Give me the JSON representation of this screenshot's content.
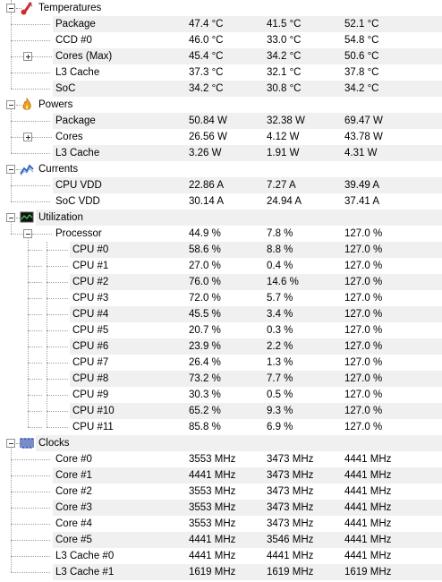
{
  "sections": [
    {
      "name": "temperatures",
      "label": "Temperatures",
      "icon": "thermometer-icon",
      "rows": [
        {
          "label": "Package",
          "level": 1,
          "expander": null,
          "values": [
            "47.4 °C",
            "41.5 °C",
            "52.1 °C"
          ]
        },
        {
          "label": "CCD #0",
          "level": 1,
          "expander": null,
          "values": [
            "46.0 °C",
            "33.0 °C",
            "54.8 °C"
          ]
        },
        {
          "label": "Cores (Max)",
          "level": 1,
          "expander": "plus",
          "values": [
            "45.4 °C",
            "34.2 °C",
            "50.6 °C"
          ]
        },
        {
          "label": "L3 Cache",
          "level": 1,
          "expander": null,
          "values": [
            "37.3 °C",
            "32.1 °C",
            "37.8 °C"
          ]
        },
        {
          "label": "SoC",
          "level": 1,
          "expander": null,
          "values": [
            "34.2 °C",
            "30.8 °C",
            "34.2 °C"
          ]
        }
      ]
    },
    {
      "name": "powers",
      "label": "Powers",
      "icon": "flame-icon",
      "rows": [
        {
          "label": "Package",
          "level": 1,
          "expander": null,
          "values": [
            "50.84 W",
            "32.38 W",
            "69.47 W"
          ]
        },
        {
          "label": "Cores",
          "level": 1,
          "expander": "plus",
          "values": [
            "26.56 W",
            "4.12 W",
            "43.78 W"
          ]
        },
        {
          "label": "L3 Cache",
          "level": 1,
          "expander": null,
          "values": [
            "3.26 W",
            "1.91 W",
            "4.31 W"
          ]
        }
      ]
    },
    {
      "name": "currents",
      "label": "Currents",
      "icon": "current-graph-icon",
      "rows": [
        {
          "label": "CPU VDD",
          "level": 1,
          "expander": null,
          "values": [
            "22.86 A",
            "7.27 A",
            "39.49 A"
          ]
        },
        {
          "label": "SoC VDD",
          "level": 1,
          "expander": null,
          "values": [
            "30.14 A",
            "24.94 A",
            "37.41 A"
          ]
        }
      ]
    },
    {
      "name": "utilization",
      "label": "Utilization",
      "icon": "monitor-chart-icon",
      "rows": [
        {
          "label": "Processor",
          "level": 1,
          "expander": "minus",
          "values": [
            "44.9 %",
            "7.8 %",
            "127.0 %"
          ]
        },
        {
          "label": "CPU #0",
          "level": 2,
          "expander": null,
          "values": [
            "58.6 %",
            "8.8 %",
            "127.0 %"
          ]
        },
        {
          "label": "CPU #1",
          "level": 2,
          "expander": null,
          "values": [
            "27.0 %",
            "0.4 %",
            "127.0 %"
          ]
        },
        {
          "label": "CPU #2",
          "level": 2,
          "expander": null,
          "values": [
            "76.0 %",
            "14.6 %",
            "127.0 %"
          ]
        },
        {
          "label": "CPU #3",
          "level": 2,
          "expander": null,
          "values": [
            "72.0 %",
            "5.7 %",
            "127.0 %"
          ]
        },
        {
          "label": "CPU #4",
          "level": 2,
          "expander": null,
          "values": [
            "45.5 %",
            "3.4 %",
            "127.0 %"
          ]
        },
        {
          "label": "CPU #5",
          "level": 2,
          "expander": null,
          "values": [
            "20.7 %",
            "0.3 %",
            "127.0 %"
          ]
        },
        {
          "label": "CPU #6",
          "level": 2,
          "expander": null,
          "values": [
            "23.9 %",
            "2.2 %",
            "127.0 %"
          ]
        },
        {
          "label": "CPU #7",
          "level": 2,
          "expander": null,
          "values": [
            "26.4 %",
            "1.3 %",
            "127.0 %"
          ]
        },
        {
          "label": "CPU #8",
          "level": 2,
          "expander": null,
          "values": [
            "73.2 %",
            "7.7 %",
            "127.0 %"
          ]
        },
        {
          "label": "CPU #9",
          "level": 2,
          "expander": null,
          "values": [
            "30.3 %",
            "0.5 %",
            "127.0 %"
          ]
        },
        {
          "label": "CPU #10",
          "level": 2,
          "expander": null,
          "values": [
            "65.2 %",
            "9.3 %",
            "127.0 %"
          ]
        },
        {
          "label": "CPU #11",
          "level": 2,
          "expander": null,
          "values": [
            "85.8 %",
            "6.9 %",
            "127.0 %"
          ]
        }
      ]
    },
    {
      "name": "clocks",
      "label": "Clocks",
      "icon": "clock-wave-icon",
      "rows": [
        {
          "label": "Core #0",
          "level": 1,
          "expander": null,
          "values": [
            "3553 MHz",
            "3473 MHz",
            "4441 MHz"
          ]
        },
        {
          "label": "Core #1",
          "level": 1,
          "expander": null,
          "values": [
            "4441 MHz",
            "3473 MHz",
            "4441 MHz"
          ]
        },
        {
          "label": "Core #2",
          "level": 1,
          "expander": null,
          "values": [
            "3553 MHz",
            "3473 MHz",
            "4441 MHz"
          ]
        },
        {
          "label": "Core #3",
          "level": 1,
          "expander": null,
          "values": [
            "3553 MHz",
            "3473 MHz",
            "4441 MHz"
          ]
        },
        {
          "label": "Core #4",
          "level": 1,
          "expander": null,
          "values": [
            "3553 MHz",
            "3473 MHz",
            "4441 MHz"
          ]
        },
        {
          "label": "Core #5",
          "level": 1,
          "expander": null,
          "values": [
            "4441 MHz",
            "3546 MHz",
            "4441 MHz"
          ]
        },
        {
          "label": "L3 Cache #0",
          "level": 1,
          "expander": null,
          "values": [
            "4441 MHz",
            "4441 MHz",
            "4441 MHz"
          ]
        },
        {
          "label": "L3 Cache #1",
          "level": 1,
          "expander": null,
          "values": [
            "1619 MHz",
            "1619 MHz",
            "1619 MHz"
          ]
        }
      ]
    }
  ],
  "colors": {
    "alt_row": "#f0f0f0",
    "tree_line": "#a0a0a0",
    "thermometer": "#d22b2b",
    "flame": "#f0a020",
    "current": "#2b5fb4",
    "monitor": "#1f8a3a",
    "clock": "#1f3fa8"
  }
}
